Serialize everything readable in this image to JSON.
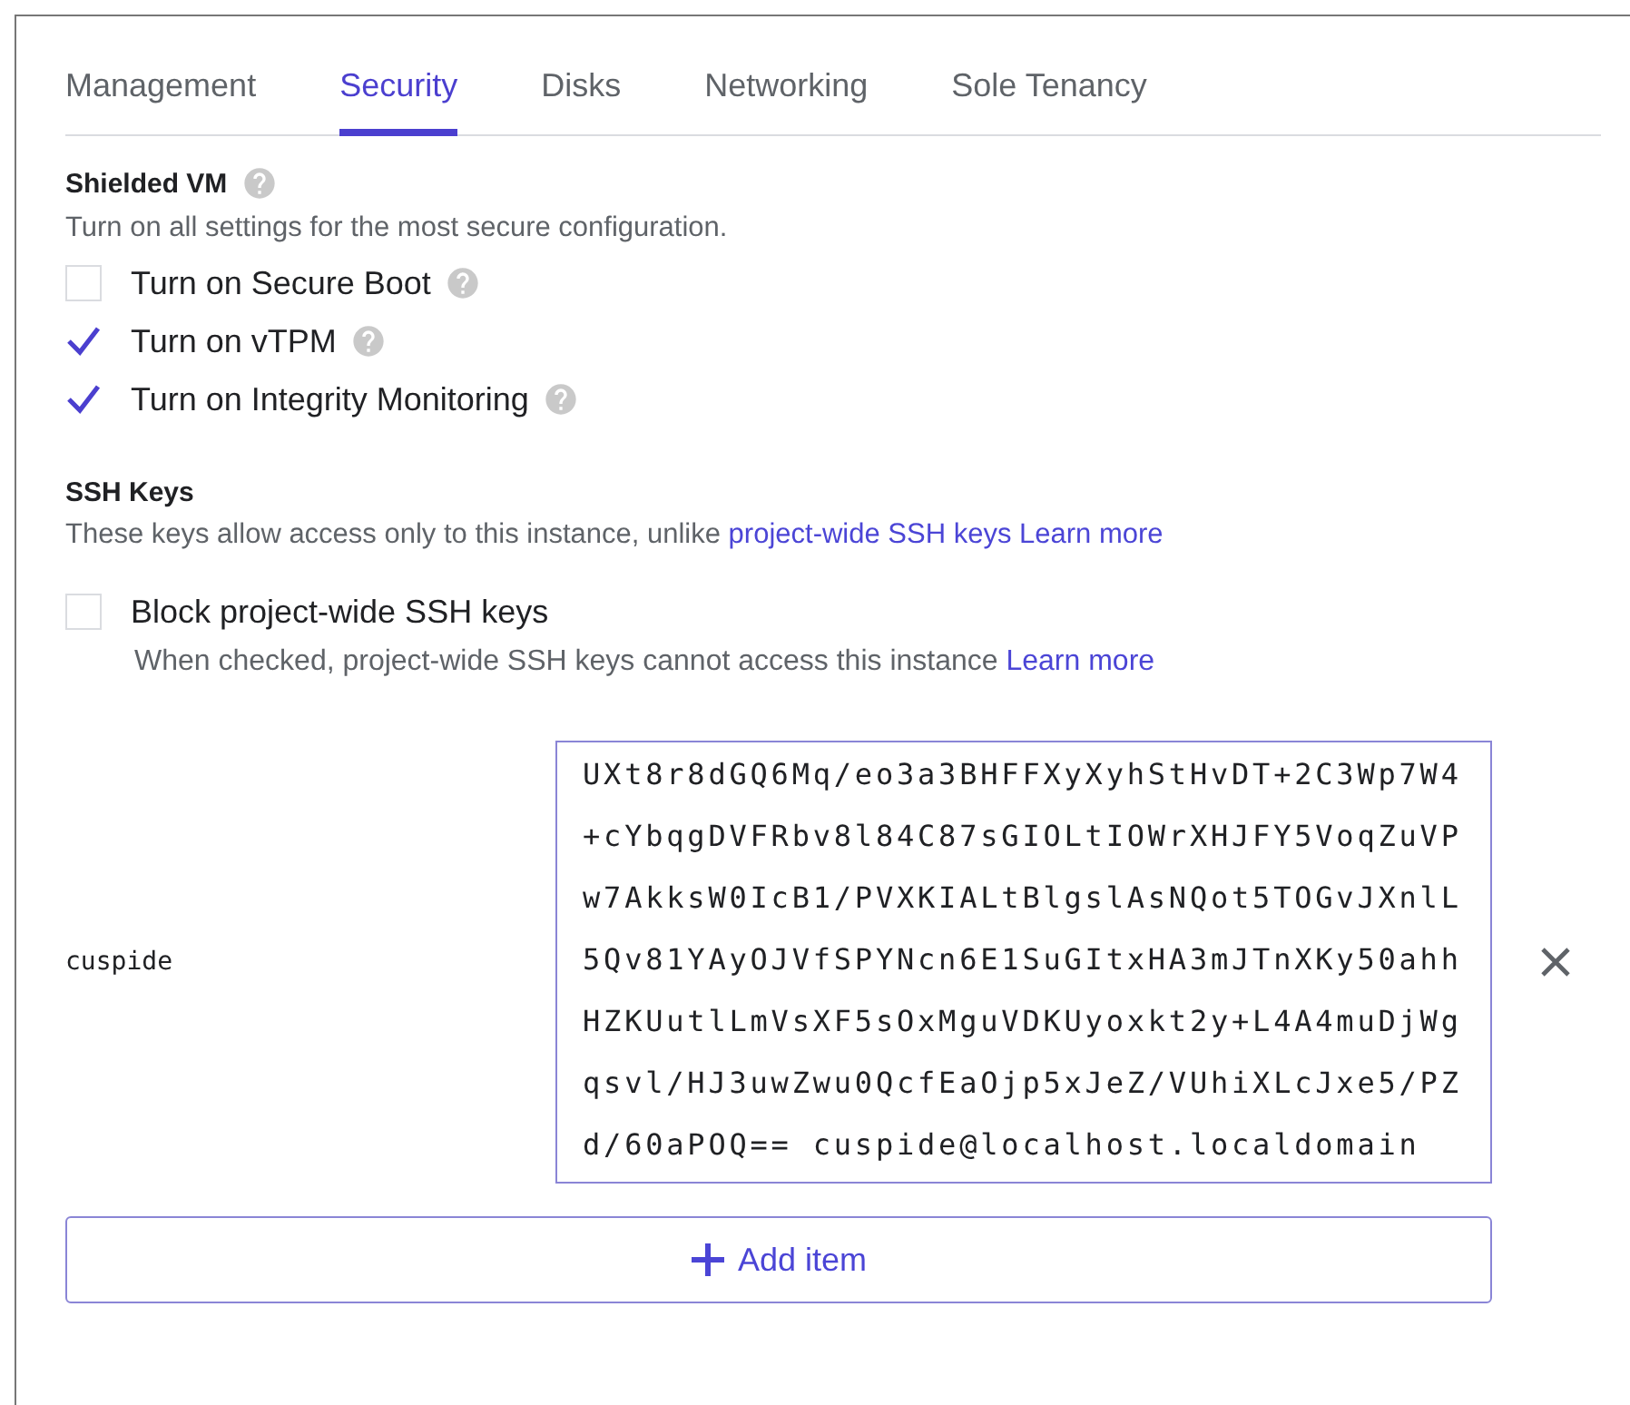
{
  "tabs": [
    {
      "label": "Management",
      "selected": false
    },
    {
      "label": "Security",
      "selected": true
    },
    {
      "label": "Disks",
      "selected": false
    },
    {
      "label": "Networking",
      "selected": false
    },
    {
      "label": "Sole Tenancy",
      "selected": false
    }
  ],
  "shielded_vm": {
    "title": "Shielded VM",
    "description": "Turn on all settings for the most secure configuration.",
    "options": [
      {
        "label": "Turn on Secure Boot",
        "checked": false
      },
      {
        "label": "Turn on vTPM",
        "checked": true
      },
      {
        "label": "Turn on Integrity Monitoring",
        "checked": true
      }
    ]
  },
  "ssh_keys": {
    "title": "SSH Keys",
    "description": "These keys allow access only to this instance, unlike",
    "links": [
      "project-wide SSH keys",
      "Learn more"
    ],
    "block_option": {
      "label": "Block project-wide SSH keys",
      "checked": false,
      "hint": "When checked, project-wide SSH keys cannot access this instance",
      "hint_link": "Learn more"
    },
    "keys": [
      {
        "username": "cuspide",
        "value": "UXt8r8dGQ6Mq/eo3a3BHFFXyXyhStHvDT+2C3Wp7W4+cYbqgDVFRbv8l84C87sGIOLtIOWrXHJFY5VoqZuVPw7AkksW0IcB1/PVXKIALtBlgslAsNQot5TOGvJXnlL5Qv81YAyOJVfSPYNcn6E1SuGItxHA3mJTnXKy50ahhHZKUutlLmVsXF5sOxMguVDKUyoxkt2y+L4A4muDjWgqsvl/HJ3uwZwu0QcfEaOjp5xJeZ/VUhiXLcJxe5/PZd/60aPOQ== cuspide@localhost.localdomain"
      }
    ],
    "add_button": "Add item"
  }
}
